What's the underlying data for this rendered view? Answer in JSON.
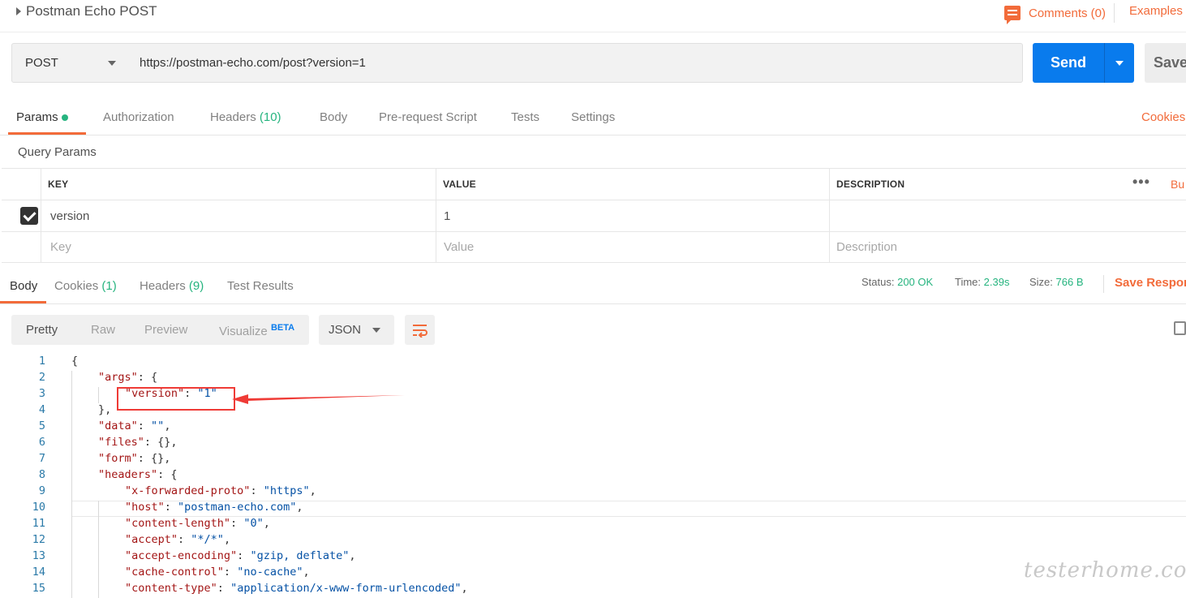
{
  "request": {
    "title": "Postman Echo POST",
    "comments_label": "Comments (0)",
    "examples_label": "Examples",
    "method": "POST",
    "url": "https://postman-echo.com/post?version=1",
    "send_label": "Send",
    "save_label": "Save"
  },
  "request_tabs": [
    {
      "label": "Params",
      "active": true
    },
    {
      "label": "Authorization"
    },
    {
      "label": "Headers",
      "count": "(10)"
    },
    {
      "label": "Body"
    },
    {
      "label": "Pre-request Script"
    },
    {
      "label": "Tests"
    },
    {
      "label": "Settings"
    }
  ],
  "cookies_link": "Cookies",
  "query_params": {
    "title": "Query Params",
    "headers": [
      "KEY",
      "VALUE",
      "DESCRIPTION"
    ],
    "more_label": "•••",
    "bulk_label": "Bu",
    "rows": [
      {
        "key": "version",
        "value": "1",
        "description": "",
        "checked": true
      }
    ],
    "placeholders": {
      "key": "Key",
      "value": "Value",
      "description": "Description"
    }
  },
  "response_tabs": [
    {
      "label": "Body",
      "active": true
    },
    {
      "label": "Cookies",
      "count": "(1)"
    },
    {
      "label": "Headers",
      "count": "(9)"
    },
    {
      "label": "Test Results"
    }
  ],
  "response_status": {
    "status_label": "Status:",
    "status_value": "200 OK",
    "time_label": "Time:",
    "time_value": "2.39s",
    "size_label": "Size:",
    "size_value": "766 B",
    "save_response": "Save Respor"
  },
  "view_modes": [
    "Pretty",
    "Raw",
    "Preview",
    "Visualize"
  ],
  "beta_label": "BETA",
  "format": "JSON",
  "code_lines": [
    {
      "n": "1",
      "indent": 0,
      "parts": [
        [
          "p",
          "{"
        ]
      ]
    },
    {
      "n": "2",
      "indent": 1,
      "parts": [
        [
          "key",
          "\"args\""
        ],
        [
          "p",
          ": {"
        ]
      ]
    },
    {
      "n": "3",
      "indent": 2,
      "parts": [
        [
          "key",
          "\"version\""
        ],
        [
          "p",
          ": "
        ],
        [
          "str",
          "\"1\""
        ]
      ]
    },
    {
      "n": "4",
      "indent": 1,
      "parts": [
        [
          "p",
          "},"
        ]
      ]
    },
    {
      "n": "5",
      "indent": 1,
      "parts": [
        [
          "key",
          "\"data\""
        ],
        [
          "p",
          ": "
        ],
        [
          "str",
          "\"\""
        ],
        [
          "p",
          ","
        ]
      ]
    },
    {
      "n": "6",
      "indent": 1,
      "parts": [
        [
          "key",
          "\"files\""
        ],
        [
          "p",
          ": {},"
        ]
      ]
    },
    {
      "n": "7",
      "indent": 1,
      "parts": [
        [
          "key",
          "\"form\""
        ],
        [
          "p",
          ": {},"
        ]
      ]
    },
    {
      "n": "8",
      "indent": 1,
      "parts": [
        [
          "key",
          "\"headers\""
        ],
        [
          "p",
          ": {"
        ]
      ]
    },
    {
      "n": "9",
      "indent": 2,
      "parts": [
        [
          "key",
          "\"x-forwarded-proto\""
        ],
        [
          "p",
          ": "
        ],
        [
          "str",
          "\"https\""
        ],
        [
          "p",
          ","
        ]
      ]
    },
    {
      "n": "10",
      "indent": 2,
      "parts": [
        [
          "key",
          "\"host\""
        ],
        [
          "p",
          ": "
        ],
        [
          "str",
          "\"postman-echo.com\""
        ],
        [
          "p",
          ","
        ]
      ]
    },
    {
      "n": "11",
      "indent": 2,
      "parts": [
        [
          "key",
          "\"content-length\""
        ],
        [
          "p",
          ": "
        ],
        [
          "str",
          "\"0\""
        ],
        [
          "p",
          ","
        ]
      ]
    },
    {
      "n": "12",
      "indent": 2,
      "parts": [
        [
          "key",
          "\"accept\""
        ],
        [
          "p",
          ": "
        ],
        [
          "str",
          "\"*/*\""
        ],
        [
          "p",
          ","
        ]
      ]
    },
    {
      "n": "13",
      "indent": 2,
      "parts": [
        [
          "key",
          "\"accept-encoding\""
        ],
        [
          "p",
          ": "
        ],
        [
          "str",
          "\"gzip, deflate\""
        ],
        [
          "p",
          ","
        ]
      ]
    },
    {
      "n": "14",
      "indent": 2,
      "parts": [
        [
          "key",
          "\"cache-control\""
        ],
        [
          "p",
          ": "
        ],
        [
          "str",
          "\"no-cache\""
        ],
        [
          "p",
          ","
        ]
      ]
    },
    {
      "n": "15",
      "indent": 2,
      "parts": [
        [
          "key",
          "\"content-type\""
        ],
        [
          "p",
          ": "
        ],
        [
          "str",
          "\"application/x-www-form-urlencoded\""
        ],
        [
          "p",
          ","
        ]
      ]
    }
  ],
  "watermark": "testerhome.com",
  "colors": {
    "accent": "#f26b3a",
    "send": "#097bed",
    "success": "#26b47f",
    "annotation": "#ef3b36"
  }
}
